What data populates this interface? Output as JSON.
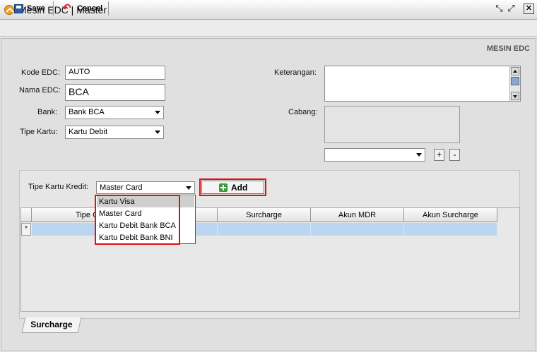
{
  "window": {
    "title": "Mesin EDC | Master"
  },
  "toolbar": {
    "save_label": "Save",
    "cancel_label": "Cancel"
  },
  "section": {
    "title": "MESIN EDC"
  },
  "form": {
    "kode_label": "Kode EDC:",
    "kode_value": "AUTO",
    "nama_label": "Nama EDC:",
    "nama_value": "BCA",
    "bank_label": "Bank:",
    "bank_value": "Bank BCA",
    "tipe_label": "Tipe Kartu:",
    "tipe_value": "Kartu Debit",
    "keterangan_label": "Keterangan:",
    "keterangan_value": "",
    "cabang_label": "Cabang:",
    "cabang_select_value": "",
    "plus_label": "+",
    "minus_label": "-"
  },
  "credit": {
    "label": "Tipe Kartu Kredit:",
    "selected": "Master Card",
    "add_label": "Add",
    "options": [
      "Kartu Visa",
      "Master Card",
      "Kartu Debit Bank BCA",
      "Kartu Debit Bank BNI"
    ],
    "highlighted_index": 0
  },
  "grid": {
    "columns": [
      "Tipe CC",
      "",
      "Surcharge",
      "Akun MDR",
      "Akun Surcharge"
    ],
    "new_row_marker": "*"
  },
  "tabs": [
    {
      "label": "Surcharge"
    }
  ],
  "colors": {
    "highlight": "#e01010",
    "selection": "#bcd6f2"
  }
}
